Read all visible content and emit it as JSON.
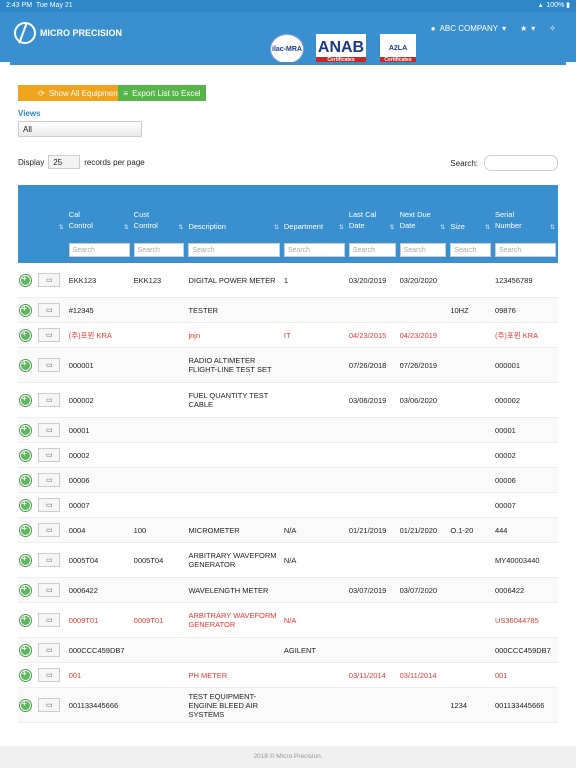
{
  "status": {
    "time": "2:43 PM",
    "date": "Tue May 21",
    "battery": "100%"
  },
  "brand": {
    "name": "MICRO PRECISION"
  },
  "top_nav": {
    "account": "ABC COMPANY"
  },
  "certs": [
    {
      "label": "ilac-MRA"
    },
    {
      "label": "ANAB",
      "sub": "Certificates"
    },
    {
      "label": "A2LA",
      "sub": "Certificates"
    }
  ],
  "toolbar": {
    "show_all": "Show All Equipments",
    "export": "Export List to Excel"
  },
  "views": {
    "label": "Views",
    "value": "All"
  },
  "paging": {
    "display": "Display",
    "length": "25",
    "suffix": "records per page",
    "search_label": "Search:"
  },
  "columns": [
    "Cal Control",
    "Cust Control",
    "Description",
    "Department",
    "Last Cal Date",
    "Next Due Date",
    "Size",
    "Serial Number"
  ],
  "filter_placeholder": "Search",
  "rows": [
    {
      "cal": "EKK123",
      "cust": "EKK123",
      "desc": "DIGITAL POWER METER",
      "dept": "1",
      "last": "03/20/2019",
      "next": "03/20/2020",
      "size": "",
      "serial": "123456789",
      "red": false
    },
    {
      "cal": "#12345",
      "cust": "",
      "desc": "TESTER",
      "dept": "",
      "last": "",
      "next": "",
      "size": "10HZ",
      "serial": "09876",
      "red": false
    },
    {
      "cal": "(주)포뮌 KRA",
      "cust": "",
      "desc": "jnjn",
      "dept": "IT",
      "last": "04/23/2015",
      "next": "04/23/2019",
      "size": "",
      "serial": "(주)포뮌 KRA",
      "red": true
    },
    {
      "cal": "000001",
      "cust": "",
      "desc": "RADIO ALTIMETER FLIGHT-LINE TEST SET",
      "dept": "",
      "last": "07/26/2018",
      "next": "07/26/2019",
      "size": "",
      "serial": "000001",
      "red": false
    },
    {
      "cal": "000002",
      "cust": "",
      "desc": "FUEL QUANTITY TEST CABLE",
      "dept": "",
      "last": "03/06/2019",
      "next": "03/06/2020",
      "size": "",
      "serial": "000002",
      "red": false
    },
    {
      "cal": "00001",
      "cust": "",
      "desc": "",
      "dept": "",
      "last": "",
      "next": "",
      "size": "",
      "serial": "00001",
      "red": false
    },
    {
      "cal": "00002",
      "cust": "",
      "desc": "",
      "dept": "",
      "last": "",
      "next": "",
      "size": "",
      "serial": "00002",
      "red": false
    },
    {
      "cal": "00006",
      "cust": "",
      "desc": "",
      "dept": "",
      "last": "",
      "next": "",
      "size": "",
      "serial": "00006",
      "red": false
    },
    {
      "cal": "00007",
      "cust": "",
      "desc": "",
      "dept": "",
      "last": "",
      "next": "",
      "size": "",
      "serial": "00007",
      "red": false
    },
    {
      "cal": "0004",
      "cust": "100",
      "desc": "MICROMETER",
      "dept": "N/A",
      "last": "01/21/2019",
      "next": "01/21/2020",
      "size": "O.1-20",
      "serial": "444",
      "red": false
    },
    {
      "cal": "0005T04",
      "cust": "0005T04",
      "desc": "ARBITRARY WAVEFORM GENERATOR",
      "dept": "N/A",
      "last": "",
      "next": "",
      "size": "",
      "serial": "MY40003440",
      "red": false
    },
    {
      "cal": "0006422",
      "cust": "",
      "desc": "WAVELENGTH METER",
      "dept": "",
      "last": "03/07/2019",
      "next": "03/07/2020",
      "size": "",
      "serial": "0006422",
      "red": false
    },
    {
      "cal": "0009T01",
      "cust": "0009T01",
      "desc": "ARBITRARY WAVEFORM GENERATOR",
      "dept": "N/A",
      "last": "",
      "next": "",
      "size": "",
      "serial": "US36044785",
      "red": true
    },
    {
      "cal": "000CCC459DB7",
      "cust": "",
      "desc": "",
      "dept": "AGILENT",
      "last": "",
      "next": "",
      "size": "",
      "serial": "000CCC459DB7",
      "red": false
    },
    {
      "cal": "001",
      "cust": "",
      "desc": "PH METER",
      "dept": "",
      "last": "03/11/2014",
      "next": "03/11/2014",
      "size": "",
      "serial": "001",
      "red": true
    },
    {
      "cal": "001133445666",
      "cust": "",
      "desc": "TEST EQUIPMENT- ENGINE BLEED AIR SYSTEMS",
      "dept": "",
      "last": "",
      "next": "",
      "size": "1234",
      "serial": "001133445666",
      "red": false
    }
  ],
  "footer": "2018 © Micro Precision."
}
